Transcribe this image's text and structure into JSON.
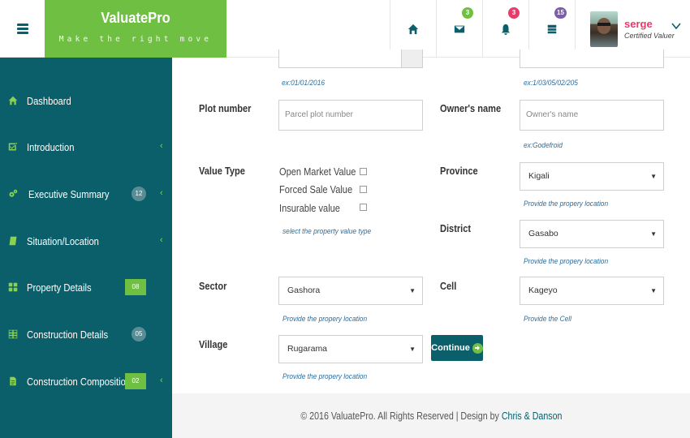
{
  "header": {
    "brand_name": "ValuatePro",
    "brand_tagline": "Make the right move",
    "messages_count": "3",
    "notifications_count": "3",
    "tasks_count": "15",
    "user_name": "serge",
    "user_role": "Certified Valuer",
    "colors": {
      "brand": "#6fc042",
      "primary": "#0a5f6a",
      "badge_green": "#6fc042",
      "badge_red": "#e63b6b",
      "badge_purple": "#7b5ea7"
    }
  },
  "sidebar": {
    "items": [
      {
        "label": "Dashboard",
        "icon": "home-icon"
      },
      {
        "label": "Introduction",
        "icon": "checkbox-icon"
      },
      {
        "label": "Executive Summary",
        "icon": "gears-icon",
        "badge": "12"
      },
      {
        "label": "Situation/Location",
        "icon": "book-icon"
      },
      {
        "label": "Property Details",
        "icon": "grid-icon",
        "badge": "08"
      },
      {
        "label": "Construction Details",
        "icon": "table-icon",
        "badge": "05"
      },
      {
        "label": "Construction Composition",
        "icon": "document-icon",
        "badge": "02"
      }
    ]
  },
  "form": {
    "top_left_hint": "ex:01/01/2016",
    "top_right_hint": "ex:1/03/05/02/205",
    "plot_number": {
      "label": "Plot number",
      "placeholder": "Parcel plot number"
    },
    "owners_name": {
      "label": "Owner's name",
      "placeholder": "Owner's name",
      "hint": "ex:Godefroid"
    },
    "value_type": {
      "label": "Value Type",
      "options": [
        "Open Market Value",
        "Forced Sale Value",
        "Insurable value"
      ],
      "hint": "select the property value type"
    },
    "province": {
      "label": "Province",
      "value": "Kigali",
      "hint": "Provide the propery location"
    },
    "district": {
      "label": "District",
      "value": "Gasabo",
      "hint": "Provide the propery location"
    },
    "sector": {
      "label": "Sector",
      "value": "Gashora",
      "hint": "Provide the propery location"
    },
    "cell": {
      "label": "Cell",
      "value": "Kageyo",
      "hint": "Provide the Cell"
    },
    "village": {
      "label": "Village",
      "value": "Rugarama",
      "hint": "Provide the propery location"
    },
    "continue_label": "Continue"
  },
  "footer": {
    "text": "© 2016 ValuatePro. All Rights Reserved | Design by",
    "link": "Chris & Danson"
  }
}
